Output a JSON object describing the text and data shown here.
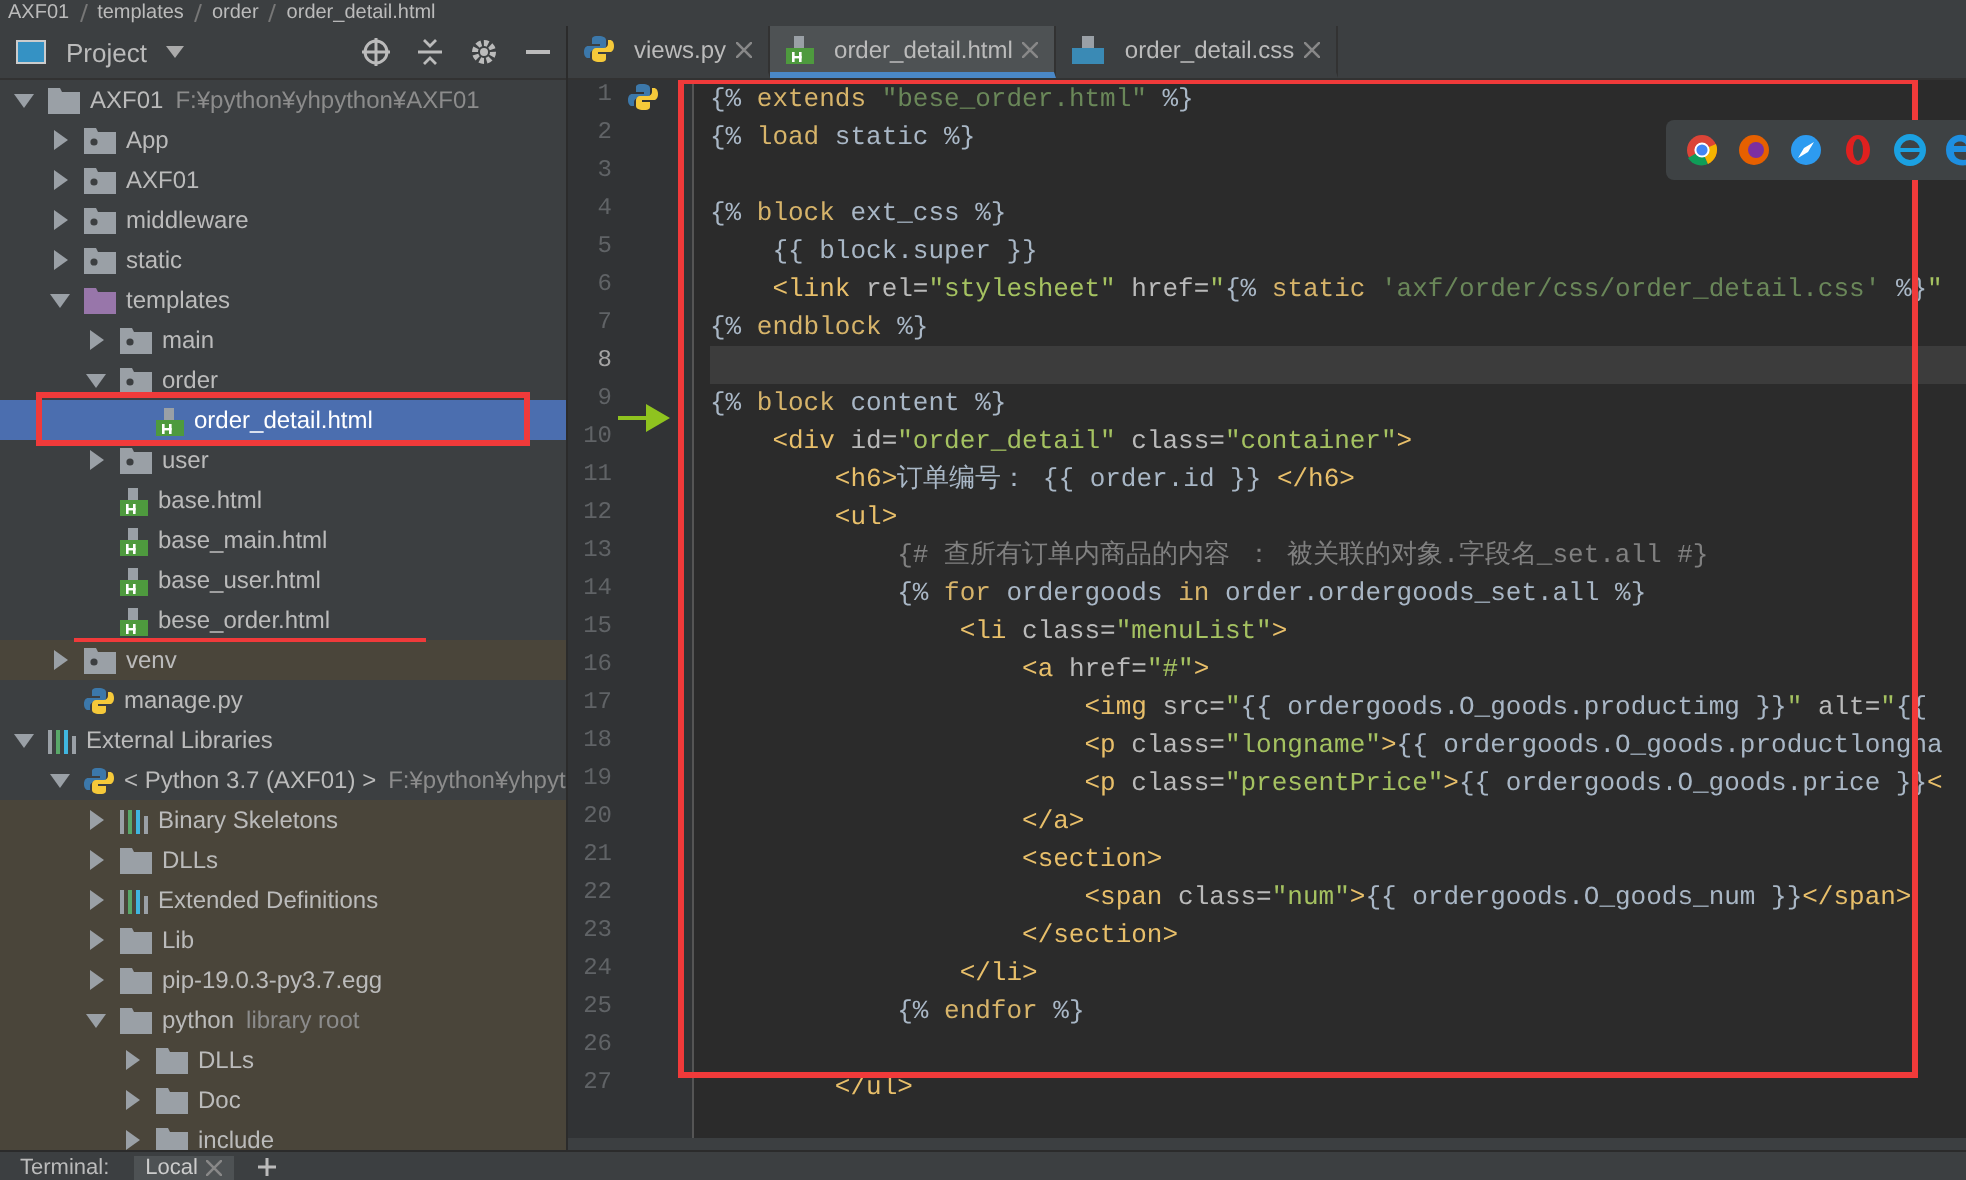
{
  "breadcrumb": [
    "AXF01",
    "templates",
    "order",
    "order_detail.html"
  ],
  "project_panel": {
    "title": "Project",
    "tree": [
      {
        "label": "AXF01",
        "detail": "F:¥python¥yhpython¥AXF01",
        "kind": "folder",
        "expanded": true,
        "selected": false,
        "children": [
          {
            "label": "App",
            "kind": "package",
            "expanded": false,
            "selected": false
          },
          {
            "label": "AXF01",
            "kind": "package",
            "expanded": false,
            "selected": false
          },
          {
            "label": "middleware",
            "kind": "package",
            "expanded": false,
            "selected": false
          },
          {
            "label": "static",
            "kind": "package",
            "expanded": false,
            "selected": false
          },
          {
            "label": "templates",
            "kind": "template-folder",
            "expanded": true,
            "selected": false,
            "children": [
              {
                "label": "main",
                "kind": "package",
                "expanded": false,
                "selected": false
              },
              {
                "label": "order",
                "kind": "package",
                "expanded": true,
                "selected": false,
                "children": [
                  {
                    "label": "order_detail.html",
                    "kind": "html",
                    "selected": true
                  }
                ]
              },
              {
                "label": "user",
                "kind": "package",
                "expanded": false,
                "selected": false
              },
              {
                "label": "base.html",
                "kind": "html",
                "selected": false
              },
              {
                "label": "base_main.html",
                "kind": "html",
                "selected": false
              },
              {
                "label": "base_user.html",
                "kind": "html",
                "selected": false
              },
              {
                "label": "bese_order.html",
                "kind": "html",
                "selected": false
              }
            ]
          },
          {
            "label": "venv",
            "kind": "package",
            "expanded": false,
            "selected": false,
            "shaded": true
          },
          {
            "label": "manage.py",
            "kind": "python-file",
            "selected": false
          }
        ]
      },
      {
        "label": "External Libraries",
        "kind": "libraries",
        "expanded": true,
        "selected": false,
        "children": [
          {
            "label": "< Python 3.7 (AXF01) >",
            "detail": "F:¥python¥yhpyt",
            "kind": "python",
            "expanded": true,
            "selected": false,
            "children": [
              {
                "label": "Binary Skeletons",
                "kind": "libraries",
                "expanded": false,
                "selected": false,
                "shaded": true
              },
              {
                "label": "DLLs",
                "kind": "folder",
                "expanded": false,
                "selected": false,
                "shaded": true
              },
              {
                "label": "Extended Definitions",
                "kind": "libraries",
                "expanded": false,
                "selected": false,
                "shaded": true
              },
              {
                "label": "Lib",
                "kind": "folder",
                "expanded": false,
                "selected": false,
                "shaded": true
              },
              {
                "label": "pip-19.0.3-py3.7.egg",
                "kind": "folder",
                "expanded": false,
                "selected": false,
                "shaded": true
              },
              {
                "label": "python",
                "detail": "library root",
                "kind": "folder",
                "expanded": true,
                "selected": false,
                "shaded": true,
                "children": [
                  {
                    "label": "DLLs",
                    "kind": "folder",
                    "expanded": false,
                    "selected": false,
                    "shaded": true
                  },
                  {
                    "label": "Doc",
                    "kind": "folder",
                    "expanded": false,
                    "selected": false,
                    "shaded": true
                  },
                  {
                    "label": "include",
                    "kind": "folder",
                    "expanded": false,
                    "selected": false,
                    "shaded": true
                  }
                ]
              }
            ]
          }
        ]
      }
    ]
  },
  "tabs": [
    {
      "label": "views.py",
      "kind": "python-file",
      "selected": false
    },
    {
      "label": "order_detail.html",
      "kind": "html",
      "selected": true
    },
    {
      "label": "order_detail.css",
      "kind": "css",
      "selected": false
    }
  ],
  "code": [
    {
      "n": "1",
      "current": false,
      "tokens": [
        {
          "kind": "delim",
          "text": "{% "
        },
        {
          "kind": "kw",
          "text": "extends "
        },
        {
          "kind": "str",
          "text": "\"bese_order.html\""
        },
        {
          "kind": "delim",
          "text": " %}"
        }
      ]
    },
    {
      "n": "2",
      "current": false,
      "tokens": [
        {
          "kind": "delim",
          "text": "{% "
        },
        {
          "kind": "kw",
          "text": "load "
        },
        {
          "kind": "text",
          "text": "static"
        },
        {
          "kind": "delim",
          "text": " %}"
        }
      ]
    },
    {
      "n": "3",
      "current": false
    },
    {
      "n": "4",
      "current": false,
      "tokens": [
        {
          "kind": "delim",
          "text": "{% "
        },
        {
          "kind": "kw",
          "text": "block "
        },
        {
          "kind": "text",
          "text": "ext_css"
        },
        {
          "kind": "delim",
          "text": " %}"
        }
      ]
    },
    {
      "n": "5",
      "current": false,
      "tokens": [
        {
          "kind": "text",
          "text": "    {{ block.super }}"
        }
      ]
    },
    {
      "n": "6",
      "current": false,
      "tokens": [
        {
          "kind": "tag",
          "text": "    <link "
        },
        {
          "kind": "attr",
          "text": "rel="
        },
        {
          "kind": "val",
          "text": "\"stylesheet\" "
        },
        {
          "kind": "attr",
          "text": "href="
        },
        {
          "kind": "val",
          "text": "\""
        },
        {
          "kind": "delim",
          "text": "{% "
        },
        {
          "kind": "kw",
          "text": "static "
        },
        {
          "kind": "str",
          "text": "'axf/order/css/order_detail.css'"
        },
        {
          "kind": "delim",
          "text": " %}"
        },
        {
          "kind": "val",
          "text": "\""
        }
      ]
    },
    {
      "n": "7",
      "current": false,
      "tokens": [
        {
          "kind": "delim",
          "text": "{% "
        },
        {
          "kind": "kw",
          "text": "endblock"
        },
        {
          "kind": "delim",
          "text": " %}"
        }
      ]
    },
    {
      "n": "8",
      "current": true
    },
    {
      "n": "9",
      "current": false,
      "tokens": [
        {
          "kind": "delim",
          "text": "{% "
        },
        {
          "kind": "kw",
          "text": "block "
        },
        {
          "kind": "text",
          "text": "content"
        },
        {
          "kind": "delim",
          "text": " %}"
        }
      ]
    },
    {
      "n": "10",
      "current": false,
      "tokens": [
        {
          "kind": "tag",
          "text": "    <div "
        },
        {
          "kind": "attr",
          "text": "id="
        },
        {
          "kind": "val",
          "text": "\"order_detail\" "
        },
        {
          "kind": "attr",
          "text": "class="
        },
        {
          "kind": "val",
          "text": "\"container\""
        },
        {
          "kind": "tag",
          "text": ">"
        }
      ]
    },
    {
      "n": "11",
      "current": false,
      "tokens": [
        {
          "kind": "tag",
          "text": "        <h6>"
        },
        {
          "kind": "text",
          "text": "订单编号： {{ order.id }} "
        },
        {
          "kind": "tag",
          "text": "</h6>"
        }
      ]
    },
    {
      "n": "12",
      "current": false,
      "tokens": [
        {
          "kind": "tag",
          "text": "        <ul>"
        }
      ]
    },
    {
      "n": "13",
      "current": false,
      "tokens": [
        {
          "kind": "comment",
          "text": "            {# 查所有订单内商品的内容 ： 被关联的对象.字段名_set.all #}"
        }
      ]
    },
    {
      "n": "14",
      "current": false,
      "tokens": [
        {
          "kind": "delim",
          "text": "            {% "
        },
        {
          "kind": "kw",
          "text": "for "
        },
        {
          "kind": "text",
          "text": "ordergoods "
        },
        {
          "kind": "kw",
          "text": "in "
        },
        {
          "kind": "text",
          "text": "order.ordergoods_set.all"
        },
        {
          "kind": "delim",
          "text": " %}"
        }
      ]
    },
    {
      "n": "15",
      "current": false,
      "tokens": [
        {
          "kind": "tag",
          "text": "                <li "
        },
        {
          "kind": "attr",
          "text": "class="
        },
        {
          "kind": "val",
          "text": "\"menuList\""
        },
        {
          "kind": "tag",
          "text": ">"
        }
      ]
    },
    {
      "n": "16",
      "current": false,
      "tokens": [
        {
          "kind": "tag",
          "text": "                    <a "
        },
        {
          "kind": "attr",
          "text": "href="
        },
        {
          "kind": "val",
          "text": "\"#\""
        },
        {
          "kind": "tag",
          "text": ">"
        }
      ]
    },
    {
      "n": "17",
      "current": false,
      "tokens": [
        {
          "kind": "tag",
          "text": "                        <img "
        },
        {
          "kind": "attr",
          "text": "src="
        },
        {
          "kind": "val",
          "text": "\""
        },
        {
          "kind": "text",
          "text": "{{ ordergoods.O_goods.productimg }}"
        },
        {
          "kind": "val",
          "text": "\" "
        },
        {
          "kind": "attr",
          "text": "alt="
        },
        {
          "kind": "val",
          "text": "\""
        },
        {
          "kind": "text",
          "text": "{{"
        }
      ]
    },
    {
      "n": "18",
      "current": false,
      "tokens": [
        {
          "kind": "tag",
          "text": "                        <p "
        },
        {
          "kind": "attr",
          "text": "class="
        },
        {
          "kind": "val",
          "text": "\"longname\""
        },
        {
          "kind": "tag",
          "text": ">"
        },
        {
          "kind": "text",
          "text": "{{ ordergoods.O_goods.productlongna"
        }
      ]
    },
    {
      "n": "19",
      "current": false,
      "tokens": [
        {
          "kind": "tag",
          "text": "                        <p "
        },
        {
          "kind": "attr",
          "text": "class="
        },
        {
          "kind": "val",
          "text": "\"presentPrice\""
        },
        {
          "kind": "tag",
          "text": ">"
        },
        {
          "kind": "text",
          "text": "{{ ordergoods.O_goods.price }}"
        },
        {
          "kind": "tag",
          "text": "<"
        }
      ]
    },
    {
      "n": "20",
      "current": false,
      "tokens": [
        {
          "kind": "tag",
          "text": "                    </a>"
        }
      ]
    },
    {
      "n": "21",
      "current": false,
      "tokens": [
        {
          "kind": "tag",
          "text": "                    <section>"
        }
      ]
    },
    {
      "n": "22",
      "current": false,
      "tokens": [
        {
          "kind": "tag",
          "text": "                        <span "
        },
        {
          "kind": "attr",
          "text": "class="
        },
        {
          "kind": "val",
          "text": "\"num\""
        },
        {
          "kind": "tag",
          "text": ">"
        },
        {
          "kind": "text",
          "text": "{{ ordergoods.O_goods_num }}"
        },
        {
          "kind": "tag",
          "text": "</span>"
        }
      ]
    },
    {
      "n": "23",
      "current": false,
      "tokens": [
        {
          "kind": "tag",
          "text": "                    </section>"
        }
      ]
    },
    {
      "n": "24",
      "current": false,
      "tokens": [
        {
          "kind": "tag",
          "text": "                </li>"
        }
      ]
    },
    {
      "n": "25",
      "current": false,
      "tokens": [
        {
          "kind": "delim",
          "text": "            {% "
        },
        {
          "kind": "kw",
          "text": "endfor"
        },
        {
          "kind": "delim",
          "text": " %}"
        }
      ]
    },
    {
      "n": "26",
      "current": false
    },
    {
      "n": "27",
      "current": false,
      "tokens": [
        {
          "kind": "tag",
          "text": "        </ul>"
        }
      ]
    }
  ],
  "bottom_bar": {
    "title": "Terminal:",
    "tabs": [
      "Local"
    ]
  }
}
